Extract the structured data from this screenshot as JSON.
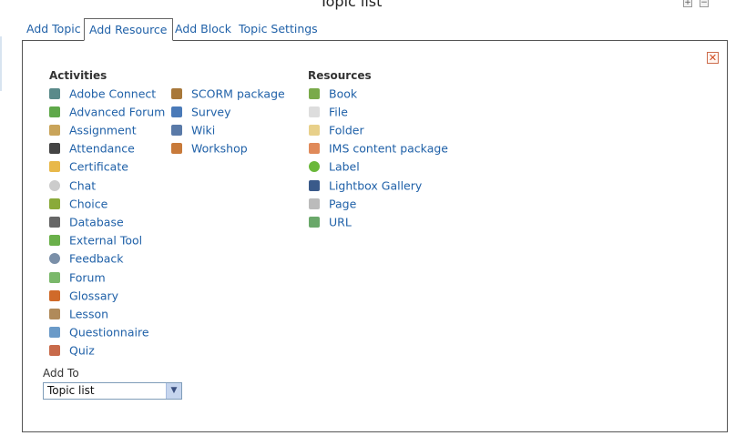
{
  "page": {
    "title": "Topic list"
  },
  "tabs": [
    {
      "label": "Add Topic"
    },
    {
      "label": "Add Resource"
    },
    {
      "label": "Add Block"
    },
    {
      "label": "Topic Settings"
    }
  ],
  "activities": {
    "heading": "Activities",
    "items": [
      {
        "label": "Adobe Connect",
        "icon": "adobe-connect-icon",
        "color": "#5a8a8a"
      },
      {
        "label": "Advanced Forum",
        "icon": "advanced-forum-icon",
        "color": "#5fa84a"
      },
      {
        "label": "Assignment",
        "icon": "assignment-icon",
        "color": "#c9a45a"
      },
      {
        "label": "Attendance",
        "icon": "attendance-icon",
        "color": "#444444"
      },
      {
        "label": "Certificate",
        "icon": "certificate-icon",
        "color": "#e8b84a"
      },
      {
        "label": "Chat",
        "icon": "chat-icon",
        "color": "#cccccc"
      },
      {
        "label": "Choice",
        "icon": "choice-icon",
        "color": "#8aaa3a"
      },
      {
        "label": "Database",
        "icon": "database-icon",
        "color": "#666666"
      },
      {
        "label": "External Tool",
        "icon": "external-tool-icon",
        "color": "#6ab04a"
      },
      {
        "label": "Feedback",
        "icon": "feedback-icon",
        "color": "#7a8fa8"
      },
      {
        "label": "Forum",
        "icon": "forum-icon",
        "color": "#7ab86a"
      },
      {
        "label": "Glossary",
        "icon": "glossary-icon",
        "color": "#d06a2a"
      },
      {
        "label": "Lesson",
        "icon": "lesson-icon",
        "color": "#b08a5a"
      },
      {
        "label": "Questionnaire",
        "icon": "questionnaire-icon",
        "color": "#6a9ac8"
      },
      {
        "label": "Quiz",
        "icon": "quiz-icon",
        "color": "#c86a4a"
      },
      {
        "label": "SCORM package",
        "icon": "scorm-package-icon",
        "color": "#a8783a"
      },
      {
        "label": "Survey",
        "icon": "survey-icon",
        "color": "#4a7ab8"
      },
      {
        "label": "Wiki",
        "icon": "wiki-icon",
        "color": "#5a7aa8"
      },
      {
        "label": "Workshop",
        "icon": "workshop-icon",
        "color": "#c87a3a"
      }
    ]
  },
  "resources": {
    "heading": "Resources",
    "items": [
      {
        "label": "Book",
        "icon": "book-icon",
        "color": "#7aaa4a"
      },
      {
        "label": "File",
        "icon": "file-icon",
        "color": "#dddddd"
      },
      {
        "label": "Folder",
        "icon": "folder-icon",
        "color": "#e8d08a"
      },
      {
        "label": "IMS content package",
        "icon": "ims-package-icon",
        "color": "#e08a5a"
      },
      {
        "label": "Label",
        "icon": "label-icon",
        "color": "#6ab83a"
      },
      {
        "label": "Lightbox Gallery",
        "icon": "lightbox-gallery-icon",
        "color": "#3a5a8a"
      },
      {
        "label": "Page",
        "icon": "page-icon",
        "color": "#bbbbbb"
      },
      {
        "label": "URL",
        "icon": "url-icon",
        "color": "#6aa86a"
      }
    ]
  },
  "add_to": {
    "label": "Add To",
    "selected": "Topic list"
  },
  "colors": {
    "link": "#2061a8",
    "border": "#555555"
  }
}
